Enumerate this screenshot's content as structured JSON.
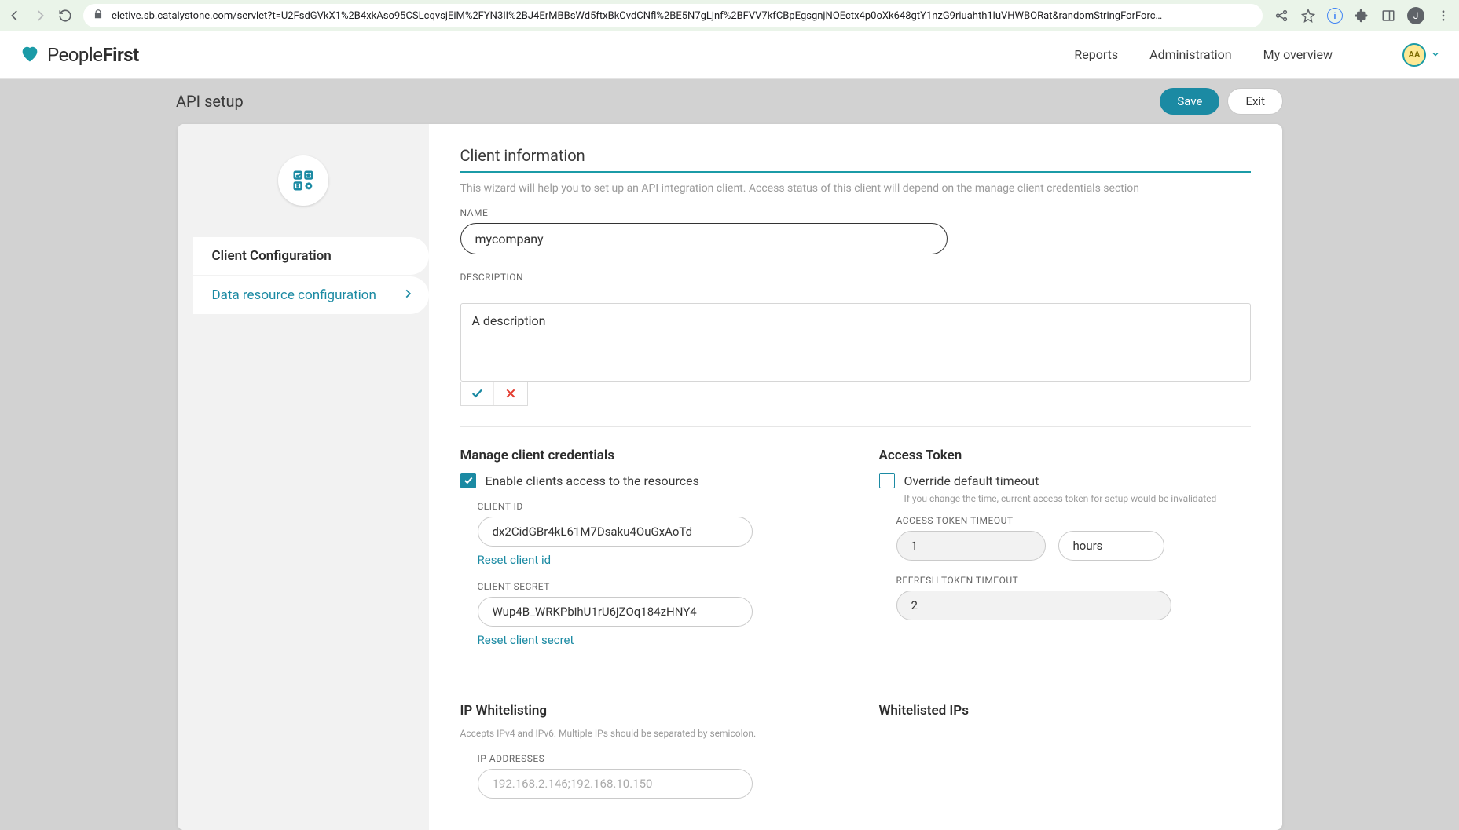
{
  "browser": {
    "url": "eletive.sb.catalystone.com/servlet?t=U2FsdGVkX1%2B4xkAso95CSLcqvsjEiM%2FYN3Il%2BJ4ErMBBsWd5ftxBkCvdCNfl%2BE5N7gLjnf%2BFVV7kfCBpEgsgnjNOEctx4p0oXk648gtY1nzG9riuahth1luVHWBORat&randomStringForForc…",
    "profile_initial": "J",
    "info_initial": "i"
  },
  "header": {
    "brand_people": "People",
    "brand_first": "First",
    "nav": {
      "reports": "Reports",
      "administration": "Administration",
      "overview": "My overview"
    },
    "avatar": "AA"
  },
  "subheader": {
    "title": "API setup",
    "save": "Save",
    "exit": "Exit"
  },
  "sidebar": {
    "item_active": "Client Configuration",
    "item_link": "Data resource configuration"
  },
  "client_info": {
    "title": "Client information",
    "help": "This wizard will help you to set up an API integration client. Access status of this client will depend on the manage client credentials section",
    "name_label": "NAME",
    "name_value": "mycompany",
    "desc_label": "DESCRIPTION",
    "desc_value": "A description"
  },
  "credentials": {
    "title": "Manage client credentials",
    "enable_label": "Enable clients access to the resources",
    "client_id_label": "CLIENT ID",
    "client_id_value": "dx2CidGBr4kL61M7Dsaku4OuGxAoTd",
    "reset_client_id": "Reset client id",
    "client_secret_label": "CLIENT SECRET",
    "client_secret_value": "Wup4B_WRKPbihU1rU6jZOq184zHNY4",
    "reset_client_secret": "Reset client secret"
  },
  "token": {
    "title": "Access Token",
    "override_label": "Override default timeout",
    "override_help": "If you change the time, current access token for setup would be invalidated",
    "access_timeout_label": "ACCESS TOKEN TIMEOUT",
    "access_timeout_value": "1",
    "access_timeout_unit": "hours",
    "refresh_timeout_label": "REFRESH TOKEN TIMEOUT",
    "refresh_timeout_value": "2"
  },
  "ip": {
    "title": "IP Whitelisting",
    "help": "Accepts IPv4 and IPv6. Multiple IPs should be separated by semicolon.",
    "addresses_label": "IP ADDRESSES",
    "addresses_placeholder": "192.168.2.146;192.168.10.150",
    "whitelisted_title": "Whitelisted IPs"
  }
}
